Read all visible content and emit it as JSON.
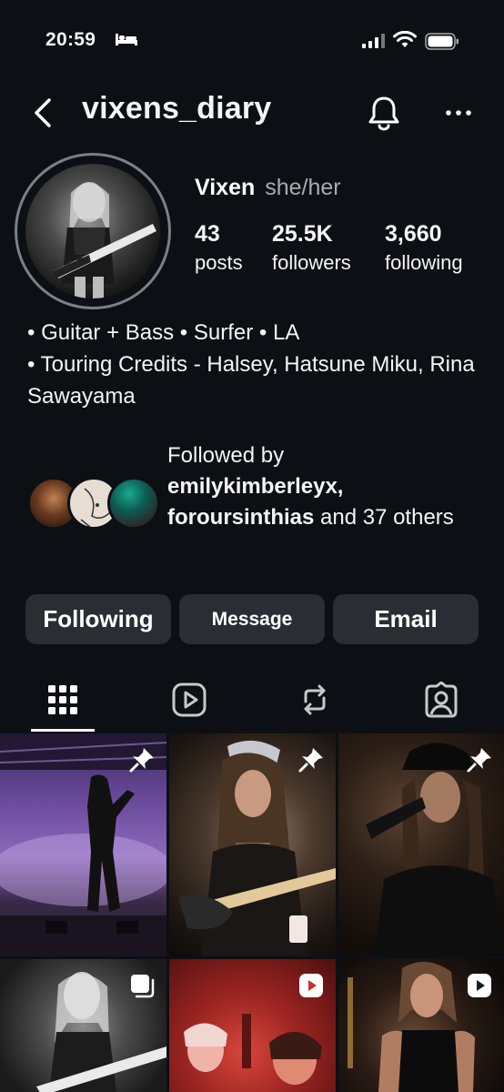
{
  "status_bar": {
    "time": "20:59"
  },
  "header": {
    "username": "vixens_diary"
  },
  "profile": {
    "name": "Vixen",
    "pronouns": "she/her",
    "stats": [
      {
        "value": "43",
        "label": "posts"
      },
      {
        "value": "25.5K",
        "label": "followers"
      },
      {
        "value": "3,660",
        "label": "following"
      }
    ],
    "bio_lines": [
      "• Guitar + Bass • Surfer • LA",
      "• Touring Credits - Halsey, Hatsune Miku, Rina Sawayama"
    ]
  },
  "followed_by": {
    "prefix": "Followed by",
    "user1": "emilykimberleyx,",
    "user2": "foroursinthias",
    "suffix": " and 37 others"
  },
  "buttons": {
    "following": "Following",
    "message": "Message",
    "email": "Email"
  },
  "tabs": [
    {
      "icon": "grid-icon",
      "active": true
    },
    {
      "icon": "reels-icon",
      "active": false
    },
    {
      "icon": "reposts-icon",
      "active": false
    },
    {
      "icon": "tagged-icon",
      "active": false
    }
  ],
  "posts": [
    {
      "badge": "pin-icon"
    },
    {
      "badge": "pin-icon"
    },
    {
      "badge": "pin-icon"
    },
    {
      "badge": "carousel-icon"
    },
    {
      "badge": "reel-icon"
    },
    {
      "badge": "reel-icon"
    }
  ]
}
